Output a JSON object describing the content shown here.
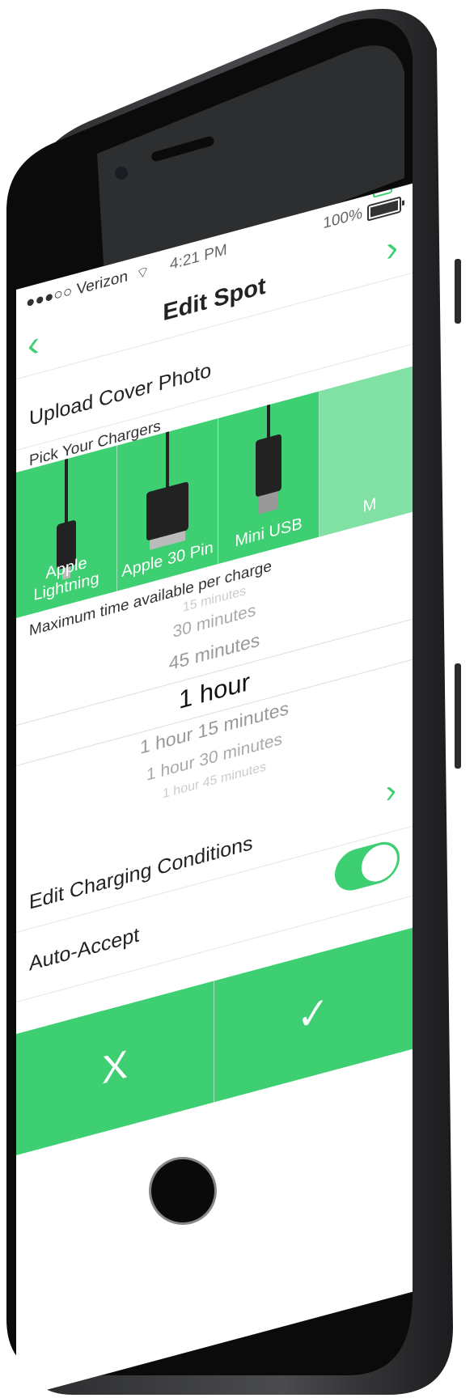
{
  "status": {
    "carrier": "●●●○○ Verizon",
    "time": "4:21 PM",
    "battery": "100%",
    "wifi_icon": "wifi-icon"
  },
  "nav": {
    "title": "Edit Spot",
    "back_icon": "chevron-left-icon",
    "forward_icon": "chevron-right-icon",
    "trash_icon": "trash-icon"
  },
  "upload_label": "Upload Cover Photo",
  "chargers_label": "Pick Your Chargers",
  "chargers": [
    {
      "name": "Apple Lightning"
    },
    {
      "name": "Apple 30 Pin"
    },
    {
      "name": "Mini USB"
    },
    {
      "name": "M"
    }
  ],
  "picker_label": "Maximum time available per charge",
  "picker": {
    "options": [
      "15 minutes",
      "30 minutes",
      "45 minutes",
      "1 hour",
      "1 hour 15 minutes",
      "1 hour 30 minutes",
      "1 hour 45 minutes"
    ],
    "selected": "1 hour"
  },
  "conditions_label": "Edit Charging Conditions",
  "autoaccept_label": "Auto-Accept",
  "autoaccept_on": true,
  "actions": {
    "cancel": "X",
    "confirm": "✓"
  },
  "colors": {
    "accent": "#3ecf72",
    "phone_body": "#3a3b3d",
    "bezel": "#0b0b0b"
  }
}
